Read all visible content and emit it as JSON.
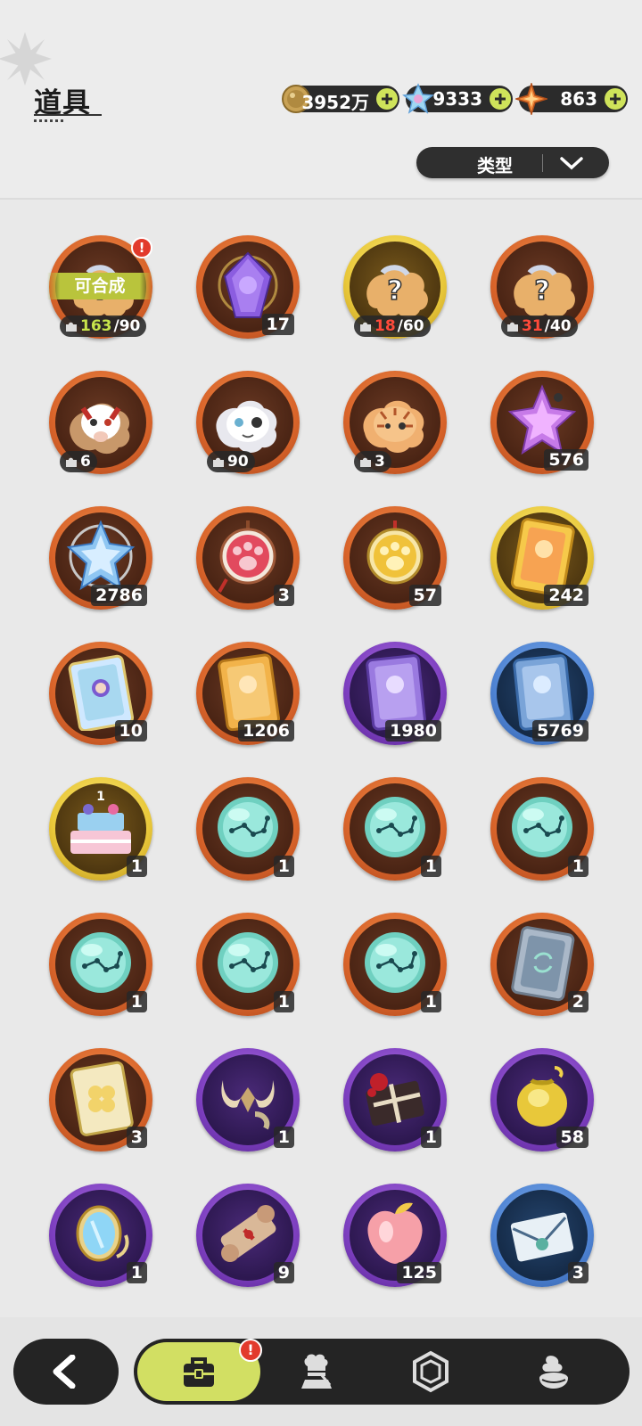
{
  "header": {
    "title": "道具",
    "currencies": [
      {
        "name": "gold-coin-icon",
        "value": "3952万"
      },
      {
        "name": "crystal-icon",
        "value": "9333"
      },
      {
        "name": "star-shard-icon",
        "value": "863"
      }
    ],
    "sort_label": "类型"
  },
  "items": [
    {
      "icon": "mystery-puzzle-icon",
      "ring": "orange",
      "badge": "可合成",
      "alert": "!",
      "frag_have": "163",
      "frag_need": "/90",
      "frag_color": "green"
    },
    {
      "icon": "purple-crystal-icon",
      "ring": "orange",
      "count": "17"
    },
    {
      "icon": "mystery-puzzle-icon",
      "ring": "gold",
      "frag_have": "18",
      "frag_need": "/60",
      "frag_color": "red"
    },
    {
      "icon": "mystery-puzzle-icon",
      "ring": "orange",
      "frag_have": "31",
      "frag_need": "/40",
      "frag_color": "red"
    },
    {
      "icon": "fox-puzzle-icon",
      "ring": "orange",
      "frag_have": "6"
    },
    {
      "icon": "white-cat-puzzle-icon",
      "ring": "orange",
      "frag_have": "90"
    },
    {
      "icon": "tiger-cat-puzzle-icon",
      "ring": "orange",
      "frag_have": "3"
    },
    {
      "icon": "pink-star-crystal-icon",
      "ring": "orange",
      "count": "576"
    },
    {
      "icon": "blue-star-crystal-icon",
      "ring": "orange",
      "count": "2786"
    },
    {
      "icon": "pink-paw-charm-icon",
      "ring": "orange",
      "count": "3"
    },
    {
      "icon": "gold-paw-charm-icon",
      "ring": "orange",
      "count": "57"
    },
    {
      "icon": "gold-character-card-icon",
      "ring": "gold",
      "count": "242"
    },
    {
      "icon": "rainbow-character-card-icon",
      "ring": "orange",
      "count": "10"
    },
    {
      "icon": "orange-character-card-icon",
      "ring": "orange",
      "count": "1206"
    },
    {
      "icon": "purple-character-card-icon",
      "ring": "purple",
      "count": "1980"
    },
    {
      "icon": "blue-character-card-icon",
      "ring": "blue",
      "count": "5769"
    },
    {
      "icon": "birthday-cake-icon",
      "ring": "gold",
      "count": "1"
    },
    {
      "icon": "constellation-orb-icon",
      "ring": "orange",
      "count": "1"
    },
    {
      "icon": "constellation-orb-icon",
      "ring": "orange",
      "count": "1"
    },
    {
      "icon": "constellation-orb-icon",
      "ring": "orange",
      "count": "1"
    },
    {
      "icon": "constellation-orb-icon",
      "ring": "orange",
      "count": "1"
    },
    {
      "icon": "constellation-orb-icon",
      "ring": "orange",
      "count": "1"
    },
    {
      "icon": "constellation-orb-icon",
      "ring": "orange",
      "count": "1"
    },
    {
      "icon": "silver-card-icon",
      "ring": "orange",
      "count": "2"
    },
    {
      "icon": "clover-card-icon",
      "ring": "orange",
      "count": "3"
    },
    {
      "icon": "horns-icon",
      "ring": "purple",
      "count": "1"
    },
    {
      "icon": "gift-box-icon",
      "ring": "purple",
      "count": "1"
    },
    {
      "icon": "gold-bag-icon",
      "ring": "purple",
      "count": "58"
    },
    {
      "icon": "magic-mirror-icon",
      "ring": "purple",
      "count": "1"
    },
    {
      "icon": "scroll-icon",
      "ring": "purple",
      "count": "9"
    },
    {
      "icon": "peach-icon",
      "ring": "purple",
      "count": "125"
    },
    {
      "icon": "letter-icon",
      "ring": "blue",
      "count": "3"
    }
  ],
  "nav": {
    "tabs": [
      {
        "name": "bag-icon",
        "active": true,
        "alert": "!"
      },
      {
        "name": "chef-icon",
        "active": false
      },
      {
        "name": "gem-icon",
        "active": false
      },
      {
        "name": "dessert-icon",
        "active": false
      }
    ]
  },
  "colors": {
    "accent": "#d2df63",
    "alert": "#e23a2c",
    "dark": "#242424"
  }
}
